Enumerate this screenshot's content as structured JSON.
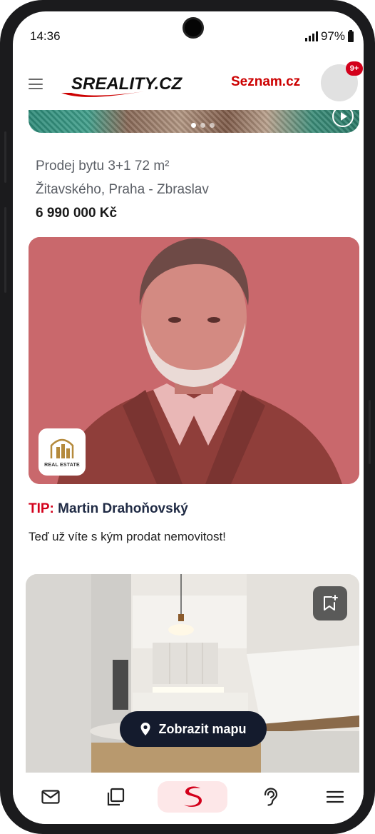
{
  "status_bar": {
    "time": "14:36",
    "battery": "97%"
  },
  "header": {
    "logo_text": "SREALITY.CZ",
    "partner_link": "Seznam.cz",
    "notification_count": "9+"
  },
  "listing": {
    "title": "Prodej bytu 3+1 72 m²",
    "address": "Žitavského, Praha - Zbraslav",
    "price": "6 990 000 Kč"
  },
  "tip": {
    "prefix": "TIP:",
    "name": "Martin Drahoňovský",
    "subtitle": "Teď už víte s kým prodat nemovitost!",
    "logo_label": "REAL ESTATE"
  },
  "map_button": {
    "label": "Zobrazit mapu"
  },
  "bottom_nav": [
    {
      "name": "messages",
      "icon": "mail-icon"
    },
    {
      "name": "saved",
      "icon": "copy-icon"
    },
    {
      "name": "home",
      "icon": "sreality-s-icon",
      "active": true
    },
    {
      "name": "hints",
      "icon": "ear-icon"
    },
    {
      "name": "menu",
      "icon": "menu-icon"
    }
  ],
  "colors": {
    "brand_red": "#cc0000",
    "badge_red": "#d3001b",
    "tip_overlay": "#c9686c",
    "map_button_bg": "#141b2d",
    "active_nav_bg": "#fde7e8"
  }
}
